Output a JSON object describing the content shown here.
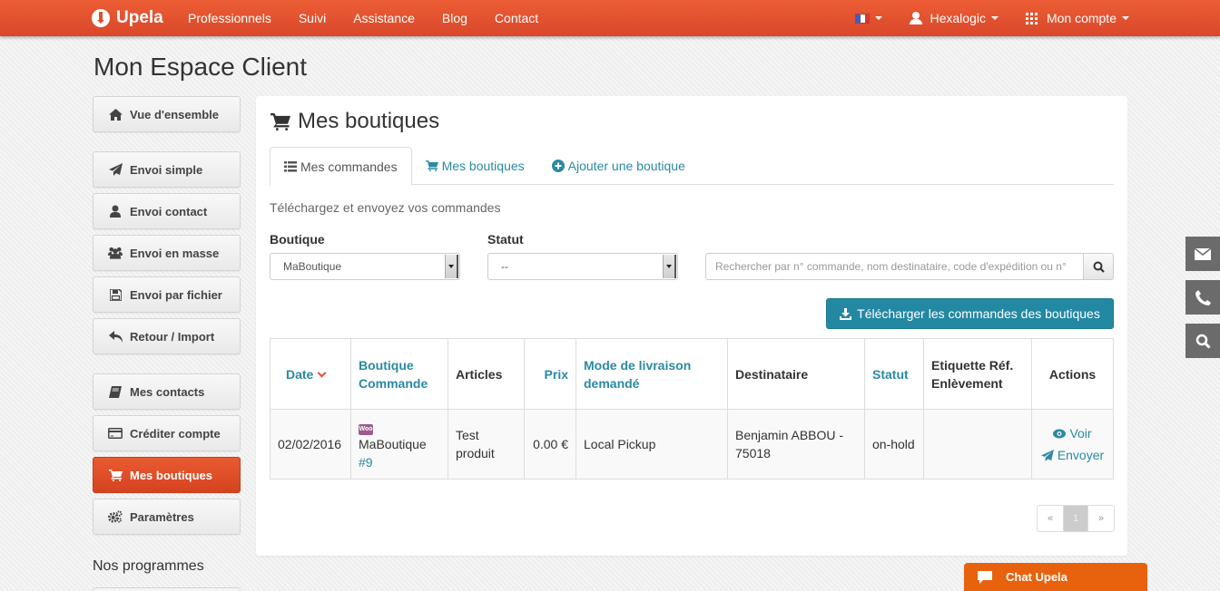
{
  "navbar": {
    "brand": "Upela",
    "links": [
      "Professionnels",
      "Suivi",
      "Assistance",
      "Blog",
      "Contact"
    ],
    "language_icon": "flag-fr-icon",
    "user": "Hexalogic",
    "account": "Mon compte",
    "colors": {
      "brand": "#e1502e"
    }
  },
  "page_title": "Mon Espace Client",
  "sidebar": {
    "items": [
      {
        "label": "Vue d'ensemble",
        "icon": "home-icon"
      },
      {
        "label": "Envoi simple",
        "icon": "paper-plane-icon"
      },
      {
        "label": "Envoi contact",
        "icon": "user-icon"
      },
      {
        "label": "Envoi en masse",
        "icon": "users-icon"
      },
      {
        "label": "Envoi par fichier",
        "icon": "floppy-icon"
      },
      {
        "label": "Retour / Import",
        "icon": "reply-icon"
      },
      {
        "label": "Mes contacts",
        "icon": "book-icon"
      },
      {
        "label": "Créditer compte",
        "icon": "credit-card-icon"
      },
      {
        "label": "Mes boutiques",
        "icon": "cart-icon",
        "active": true
      },
      {
        "label": "Paramètres",
        "icon": "gears-icon"
      }
    ],
    "section_title": "Nos programmes"
  },
  "panel": {
    "title": "Mes boutiques",
    "tabs": [
      {
        "label": "Mes commandes",
        "active": true
      },
      {
        "label": "Mes boutiques"
      },
      {
        "label": "Ajouter une boutique"
      }
    ],
    "subtitle": "Téléchargez et envoyez vos commandes",
    "filters": {
      "boutique_label": "Boutique",
      "boutique_value": "MaBoutique",
      "statut_label": "Statut",
      "statut_value": "--",
      "search_placeholder": "Rechercher par n° commande, nom destinataire, code d'expédition ou n°"
    },
    "download_button": "Télécharger les commandes des boutiques",
    "table": {
      "headers": [
        "Date",
        "Boutique Commande",
        "Articles",
        "Prix",
        "Mode de livraison demandé",
        "Destinataire",
        "Statut",
        "Etiquette Réf. Enlèvement",
        "Actions"
      ],
      "rows": [
        {
          "date": "02/02/2016",
          "shop_badge": "Woo",
          "shop": "MaBoutique",
          "order": "#9",
          "articles": "Test produit",
          "prix": "0.00 €",
          "livraison": "Local Pickup",
          "destinataire": "Benjamin ABBOU - 75018",
          "statut": "on-hold",
          "etiquette": "",
          "action_view": "Voir",
          "action_send": "Envoyer"
        }
      ]
    },
    "pagination": {
      "prev": "«",
      "current": "1",
      "next": "»"
    }
  },
  "side_tools": [
    "mail-icon",
    "phone-icon",
    "search-icon"
  ],
  "chat": {
    "label": "Chat Upela"
  }
}
